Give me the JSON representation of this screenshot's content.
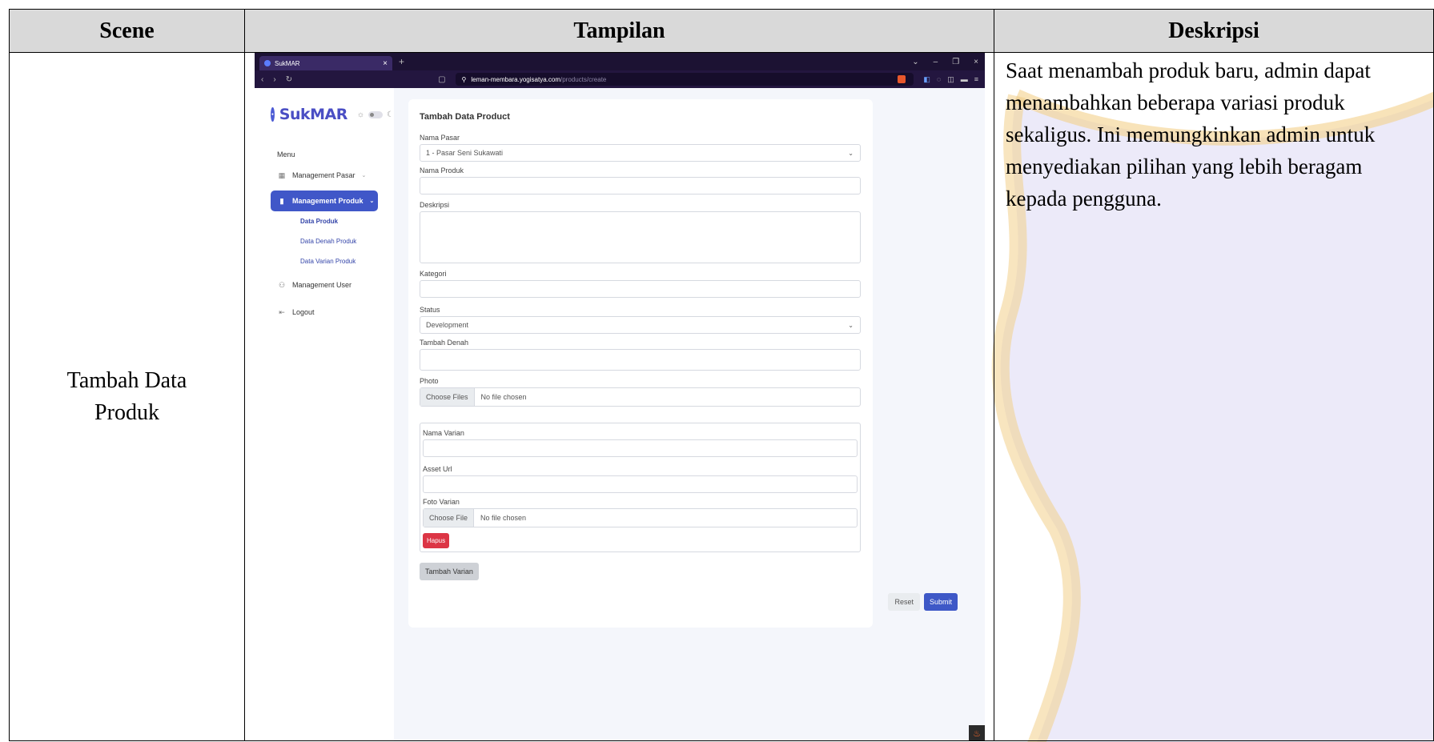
{
  "table": {
    "headers": [
      "Scene",
      "Tampilan",
      "Deskripsi"
    ],
    "scene": "Tambah Data Produk",
    "description": "Saat menambah produk baru, admin dapat menambahkan beberapa variasi produk sekaligus. Ini memungkinkan admin untuk menyediakan pilihan yang lebih beragam kepada pengguna."
  },
  "browser": {
    "tab_title": "SukMAR",
    "url_host": "leman-membara.yogisatya.com",
    "url_path": "/products/create"
  },
  "sidebar": {
    "logo": "SukMAR",
    "menu_title": "Menu",
    "items": [
      {
        "label": "Management Pasar"
      },
      {
        "label": "Management Produk"
      },
      {
        "label": "Management User"
      },
      {
        "label": "Logout"
      }
    ],
    "submenu": [
      "Data Produk",
      "Data Denah Produk",
      "Data Varian Produk"
    ]
  },
  "form": {
    "title": "Tambah Data Product",
    "nama_pasar_label": "Nama Pasar",
    "nama_pasar_value": "1 - Pasar Seni Sukawati",
    "nama_produk_label": "Nama Produk",
    "deskripsi_label": "Deskripsi",
    "kategori_label": "Kategori",
    "status_label": "Status",
    "status_value": "Development",
    "tambah_denah_label": "Tambah Denah",
    "photo_label": "Photo",
    "photo_button": "Choose Files",
    "photo_status": "No file chosen",
    "variant": {
      "nama_varian_label": "Nama Varian",
      "asset_url_label": "Asset Url",
      "foto_varian_label": "Foto Varian",
      "foto_button": "Choose File",
      "foto_status": "No file chosen",
      "hapus": "Hapus"
    },
    "tambah_varian": "Tambah Varian",
    "reset": "Reset",
    "submit": "Submit"
  },
  "colors": {
    "primary": "#4057c8",
    "danger": "#dc3545",
    "header_bg": "#d9d9d9"
  }
}
